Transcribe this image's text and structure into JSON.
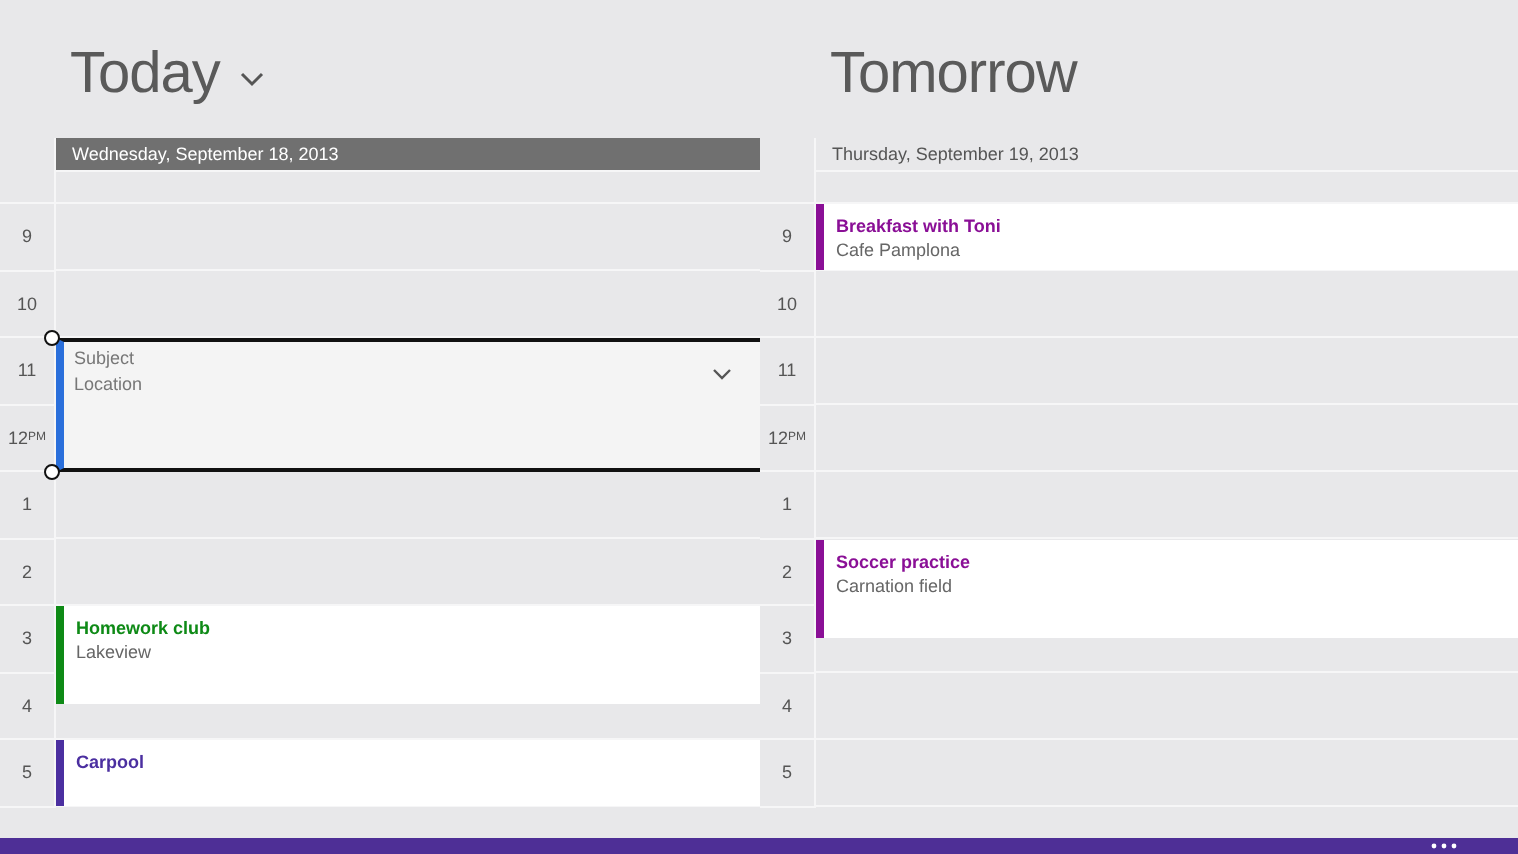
{
  "days": [
    {
      "title": "Today",
      "has_dropdown": true,
      "date": "Wednesday, September 18, 2013",
      "selected": true,
      "hours": [
        {
          "label": "9"
        },
        {
          "label": "10"
        },
        {
          "label": "11",
          "new_event": {
            "kind": "double",
            "subject_placeholder": "Subject",
            "location_placeholder": "Location",
            "color": "#2a6fdb"
          }
        },
        {
          "label": "12PM"
        },
        {
          "label": "1"
        },
        {
          "label": "2"
        },
        {
          "label": "3",
          "event": {
            "title": "Homework club",
            "location": "Lakeview",
            "kind": "ninety",
            "color": "#0e8a16"
          }
        },
        {
          "label": "4"
        },
        {
          "label": "5",
          "event": {
            "title": "Carpool",
            "kind": "hour",
            "color": "#4b2fa0"
          }
        }
      ]
    },
    {
      "title": "Tomorrow",
      "date": "Thursday, September 19, 2013",
      "selected": false,
      "hours": [
        {
          "label": "9",
          "event": {
            "title": "Breakfast with Toni",
            "location": "Cafe Pamplona",
            "kind": "hour",
            "color": "#8a0f96"
          }
        },
        {
          "label": "10"
        },
        {
          "label": "11"
        },
        {
          "label": "12PM"
        },
        {
          "label": "1"
        },
        {
          "label": "2",
          "event": {
            "title": "Soccer practice",
            "location": "Carnation field",
            "kind": "ninety",
            "color": "#8a0f96"
          }
        },
        {
          "label": "3"
        },
        {
          "label": "4"
        },
        {
          "label": "5"
        }
      ]
    }
  ],
  "app_bar": {
    "more_button": true
  }
}
